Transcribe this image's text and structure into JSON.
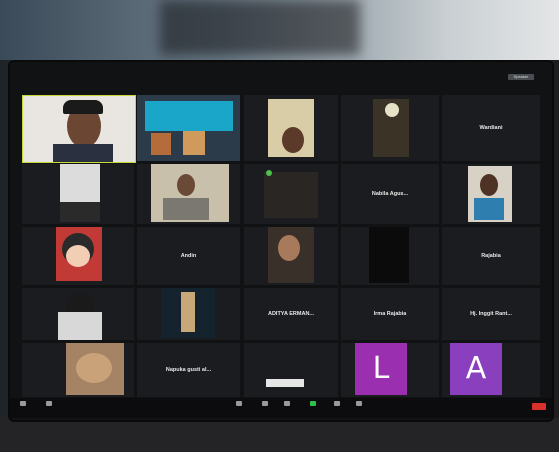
{
  "meeting": {
    "view_button": "Speaker",
    "grid": [
      {
        "name": "",
        "label": "",
        "kind": "video-man"
      },
      {
        "name": "",
        "label": "",
        "kind": "video-banner"
      },
      {
        "name": "",
        "label": "",
        "kind": "video-person"
      },
      {
        "name": "",
        "label": "",
        "kind": "video-dark"
      },
      {
        "name": "",
        "label": "Wardiani",
        "kind": "name-only"
      },
      {
        "name": "",
        "label": "",
        "kind": "video-white"
      },
      {
        "name": "",
        "label": "",
        "kind": "video-person2"
      },
      {
        "name": "",
        "label": "",
        "kind": "video-text"
      },
      {
        "name": "",
        "label": "Nabila Agus...",
        "kind": "name-only"
      },
      {
        "name": "",
        "label": "",
        "kind": "video-kid"
      },
      {
        "name": "",
        "label": "",
        "kind": "video-anime"
      },
      {
        "name": "",
        "label": "Andin",
        "kind": "name-only"
      },
      {
        "name": "",
        "label": "",
        "kind": "video-person3"
      },
      {
        "name": "",
        "label": "",
        "kind": "video-dark2"
      },
      {
        "name": "",
        "label": "Rajabia",
        "kind": "name-only"
      },
      {
        "name": "",
        "label": "",
        "kind": "video-person4"
      },
      {
        "name": "",
        "label": "",
        "kind": "video-figure"
      },
      {
        "name": "",
        "label": "ADITYA ERMAN...",
        "kind": "name-only"
      },
      {
        "name": "",
        "label": "Irma Rajabia",
        "kind": "name-only"
      },
      {
        "name": "",
        "label": "Hj. Inggit Rant...",
        "kind": "name-only"
      },
      {
        "name": "",
        "label": "",
        "kind": "video-cat"
      },
      {
        "name": "",
        "label": "Napuka gusti al...",
        "kind": "name-only"
      },
      {
        "name": "",
        "label": "",
        "kind": "screen-share"
      },
      {
        "name": "",
        "label": "",
        "kind": "avatar-L"
      },
      {
        "name": "",
        "label": "",
        "kind": "avatar-A"
      }
    ],
    "avatars": {
      "L": {
        "letter": "L",
        "color": "#9a2fb0"
      },
      "A": {
        "letter": "A",
        "color": "#8a3fbf"
      }
    }
  }
}
